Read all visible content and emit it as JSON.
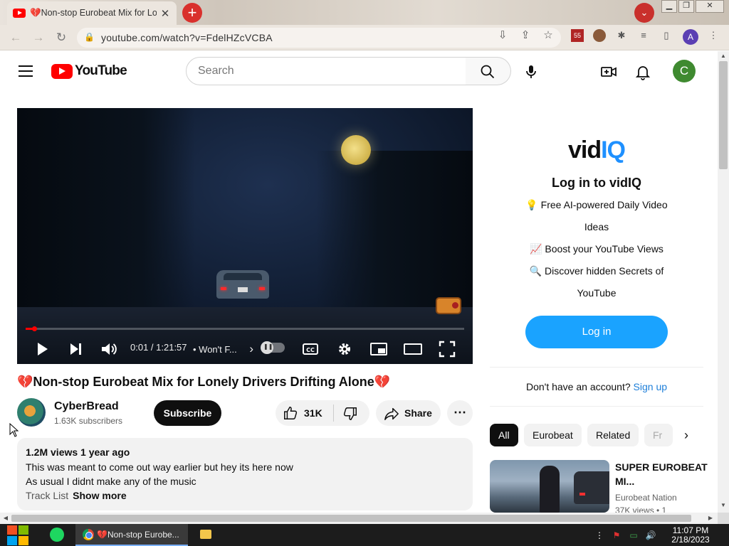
{
  "browser": {
    "tab_title": "💔Non-stop Eurobeat Mix for Lonely Drivers Drifting Alone💔",
    "tab_close": "✕",
    "new_tab": "+",
    "url": "youtube.com/watch?v=FdelHZcVCBA",
    "extension_badge": "55",
    "profile_initial": "A"
  },
  "youtube": {
    "logo_text": "YouTube",
    "search_placeholder": "Search",
    "search_value": "",
    "avatar_initial": "C"
  },
  "player": {
    "time": "0:01 / 1:21:57",
    "chapter": "• Won't F...",
    "chapter_arrow": "›",
    "progress_fraction": 0.0002,
    "loaded_fraction": 0.02
  },
  "video": {
    "title": "💔Non-stop Eurobeat Mix for Lonely Drivers Drifting Alone💔",
    "channel_name": "CyberBread",
    "subscribers": "1.63K subscribers",
    "subscribe_label": "Subscribe",
    "likes": "31K",
    "share_label": "Share",
    "more_label": "⋯",
    "description": {
      "meta": "1.2M views  1 year ago",
      "lines": [
        "This was meant to come out way earlier but hey its here now",
        "As usual I didnt make any of the music"
      ],
      "last_line": "Track List",
      "show_more": "Show more"
    }
  },
  "vidiq": {
    "logo_v": "vid",
    "logo_iq": "IQ",
    "heading": "Log in to vidIQ",
    "features": [
      "💡 Free AI-powered Daily Video Ideas",
      "📈 Boost your YouTube Views",
      "🔍 Discover hidden Secrets of YouTube"
    ],
    "login_label": "Log in",
    "no_account": "Don't have an account?",
    "signup_label": "Sign up"
  },
  "chips": [
    "All",
    "Eurobeat",
    "Related",
    "Fr"
  ],
  "chip_next": "›",
  "recommended": {
    "title": "SUPER EUROBEAT MI...",
    "channel": "Eurobeat Nation",
    "meta": "37K views  • 1"
  },
  "taskbar": {
    "chrome_label": "💔Non-stop Eurobe...",
    "time": "11:07 PM",
    "date": "2/18/2023"
  }
}
